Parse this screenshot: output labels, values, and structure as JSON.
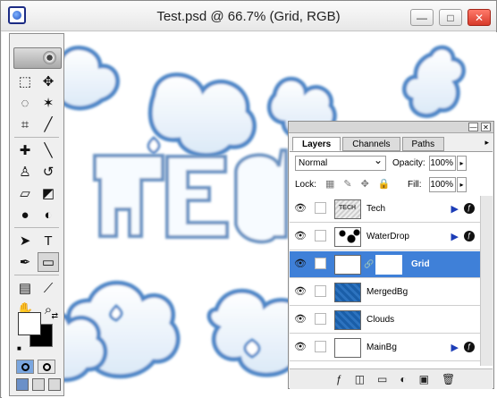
{
  "window": {
    "title": "Test.psd @ 66.7% (Grid, RGB)",
    "buttons": {
      "minimize": "—",
      "maximize": "□",
      "close": "✕"
    }
  },
  "toolbox": {
    "tools": [
      "marquee-icon",
      "move-icon",
      "lasso-icon",
      "magic-wand-icon",
      "crop-icon",
      "slice-icon",
      "healing-icon",
      "brush-icon",
      "stamp-icon",
      "history-brush-icon",
      "eraser-icon",
      "paint-bucket-icon",
      "blur-icon",
      "dodge-icon",
      "path-selection-icon",
      "type-icon",
      "pen-icon",
      "rectangle-icon",
      "notes-icon",
      "eyedropper-icon",
      "hand-icon",
      "zoom-icon"
    ]
  },
  "layers_panel": {
    "tabs": [
      "Layers",
      "Channels",
      "Paths"
    ],
    "blend_mode": "Normal",
    "opacity_label": "Opacity:",
    "opacity_value": "100%",
    "lock_label": "Lock:",
    "fill_label": "Fill:",
    "fill_value": "100%",
    "layers": [
      {
        "name": "Tech",
        "selected": false
      },
      {
        "name": "WaterDrop",
        "selected": false
      },
      {
        "name": "Grid",
        "selected": true
      },
      {
        "name": "MergedBg",
        "selected": false
      },
      {
        "name": "Clouds",
        "selected": false
      },
      {
        "name": "MainBg",
        "selected": false
      }
    ]
  },
  "colors": {
    "accent": "#3f80d8",
    "cloud_outline": "#4f87c7",
    "canvas": "#ffffff"
  }
}
